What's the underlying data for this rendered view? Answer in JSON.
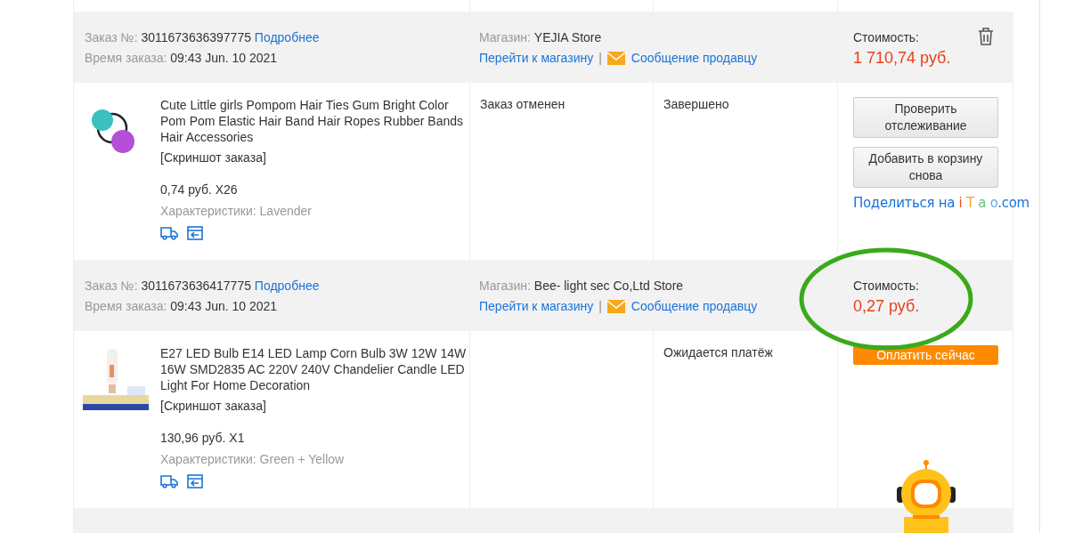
{
  "orders": [
    {
      "order_label": "Заказ №:",
      "order_number": "3011673636397775",
      "details_link": "Подробнее",
      "time_label": "Время заказа:",
      "time": "09:43 Jun. 10 2021",
      "store_label": "Магазин:",
      "store": "YEJIA Store",
      "store_link": "Перейти к магазину",
      "separator": "|",
      "message_link": "Сообщение продавцу",
      "cost_label": "Стоимость:",
      "cost": "1 710,74 руб.",
      "deletable": true,
      "highlighted": false,
      "item": {
        "title": "Cute Little girls Pompom Hair Ties Gum Bright Color Pom Pom Elastic Hair Band Hair Ropes Rubber Bands Hair Accessories",
        "snapshot": "[Скриншот заказа]",
        "price": "0,74 руб. X26",
        "specs": "Характеристики: Lavender",
        "status": "Заказ отменен",
        "status_2": "Завершено"
      },
      "actions": [
        {
          "kind": "button",
          "label": "Проверить отслеживание"
        },
        {
          "kind": "button",
          "label": "Добавить в корзину снова"
        },
        {
          "kind": "share",
          "parts": [
            {
              "text": "Поделиться на ",
              "color": "#1a73d9"
            },
            {
              "text": "i ",
              "color": "#e8522c"
            },
            {
              "text": "T ",
              "color": "#f0a030"
            },
            {
              "text": "a ",
              "color": "#6cc08b"
            },
            {
              "text": "o",
              "color": "#62aee0"
            },
            {
              "text": ".com",
              "color": "#1a73d9"
            }
          ]
        }
      ]
    },
    {
      "order_label": "Заказ №:",
      "order_number": "3011673636417775",
      "details_link": "Подробнее",
      "time_label": "Время заказа:",
      "time": "09:43 Jun. 10 2021",
      "store_label": "Магазин:",
      "store": "Bee- light sec Co,Ltd Store",
      "store_link": "Перейти к магазину",
      "separator": "|",
      "message_link": "Сообщение продавцу",
      "cost_label": "Стоимость:",
      "cost": "0,27 руб.",
      "deletable": false,
      "highlighted": true,
      "item": {
        "title": "E27 LED Bulb E14 LED Lamp Corn Bulb 3W 12W 14W 16W SMD2835 AC 220V 240V Chandelier Candle LED Light For Home Decoration",
        "snapshot": "[Скриншот заказа]",
        "price": "130,96 руб. X1",
        "specs": "Характеристики: Green + Yellow",
        "status_2": "Ожидается платёж"
      },
      "actions": [
        {
          "kind": "primary",
          "label": "Оплатить сейчас"
        }
      ]
    }
  ]
}
